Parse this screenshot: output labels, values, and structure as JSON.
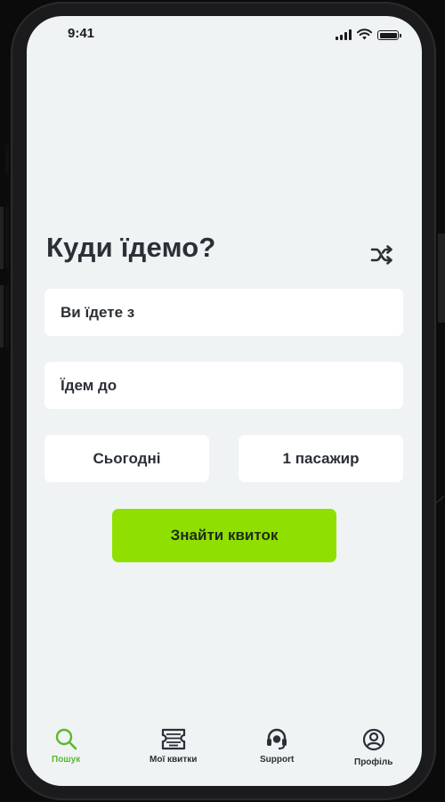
{
  "status_bar": {
    "time": "9:41",
    "icons": [
      "signal-icon",
      "wifi-icon",
      "battery-icon"
    ]
  },
  "search": {
    "title": "Куди їдемо?",
    "from_placeholder": "Ви їдете з",
    "to_placeholder": "Їдем до",
    "date_value": "Сьогодні",
    "passengers_value": "1 пасажир",
    "submit_label": "Знайти квиток"
  },
  "tabbar": {
    "items": [
      {
        "label": "Пошук",
        "icon": "search-icon",
        "active": true
      },
      {
        "label": "Мої квитки",
        "icon": "ticket-icon",
        "active": false
      },
      {
        "label": "Support",
        "icon": "headset-icon",
        "active": false
      },
      {
        "label": "Профіль",
        "icon": "profile-icon",
        "active": false
      }
    ]
  },
  "colors": {
    "accent": "#8fe000",
    "active_tab": "#5cb82e",
    "screen_bg": "#eff3f4",
    "text": "#2b2f36",
    "frame": "#1b1b1d"
  }
}
